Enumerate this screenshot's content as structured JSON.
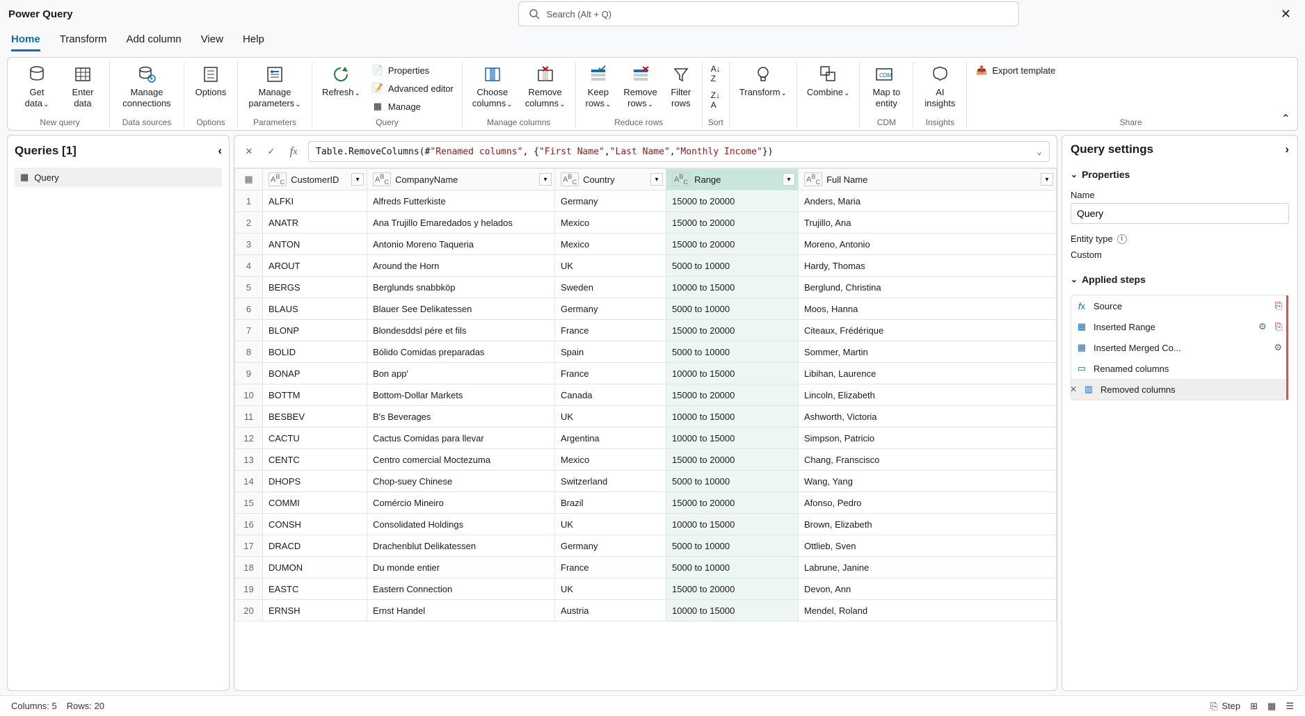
{
  "title": "Power Query",
  "search_placeholder": "Search (Alt + Q)",
  "tabs": [
    "Home",
    "Transform",
    "Add column",
    "View",
    "Help"
  ],
  "active_tab": 0,
  "ribbon": {
    "new_query": {
      "get_data": "Get\ndata",
      "enter_data": "Enter\ndata",
      "label": "New query"
    },
    "data_sources": {
      "manage_connections": "Manage\nconnections",
      "label": "Data sources"
    },
    "options_group": {
      "options": "Options",
      "label": "Options"
    },
    "parameters": {
      "manage_parameters": "Manage\nparameters",
      "label": "Parameters"
    },
    "query": {
      "refresh": "Refresh",
      "properties": "Properties",
      "advanced_editor": "Advanced editor",
      "manage": "Manage",
      "label": "Query"
    },
    "manage_columns": {
      "choose": "Choose\ncolumns",
      "remove": "Remove\ncolumns",
      "label": "Manage columns"
    },
    "reduce_rows": {
      "keep": "Keep\nrows",
      "remove": "Remove\nrows",
      "filter": "Filter\nrows",
      "label": "Reduce rows"
    },
    "sort": {
      "label": "Sort"
    },
    "transform": {
      "transform": "Transform",
      "label": ""
    },
    "combine": {
      "combine": "Combine",
      "label": ""
    },
    "cdm": {
      "map": "Map to\nentity",
      "label": "CDM"
    },
    "insights": {
      "ai": "AI\ninsights",
      "label": "Insights"
    },
    "share": {
      "export": "Export template",
      "label": "Share"
    }
  },
  "queries": {
    "header": "Queries [1]",
    "items": [
      {
        "name": "Query"
      }
    ]
  },
  "formula": {
    "prefix": "Table.RemoveColumns(#",
    "arg1": "\"Renamed columns\"",
    "sep1": ", {",
    "s1": "\"First Name\"",
    "c1": ", ",
    "s2": "\"Last Name\"",
    "c2": ", ",
    "s3": "\"Monthly Income\"",
    "suffix": "})"
  },
  "columns": [
    {
      "name": "CustomerID",
      "type": "ABC"
    },
    {
      "name": "CompanyName",
      "type": "ABC"
    },
    {
      "name": "Country",
      "type": "ABC"
    },
    {
      "name": "Range",
      "type": "ABC",
      "selected": true
    },
    {
      "name": "Full Name",
      "type": "ABC"
    }
  ],
  "rows": [
    [
      "ALFKI",
      "Alfreds Futterkiste",
      "Germany",
      "15000 to 20000",
      "Anders, Maria"
    ],
    [
      "ANATR",
      "Ana Trujillo Emaredados y helados",
      "Mexico",
      "15000 to 20000",
      "Trujillo, Ana"
    ],
    [
      "ANTON",
      "Antonio Moreno Taqueria",
      "Mexico",
      "15000 to 20000",
      "Moreno, Antonio"
    ],
    [
      "AROUT",
      "Around the Horn",
      "UK",
      "5000 to 10000",
      "Hardy, Thomas"
    ],
    [
      "BERGS",
      "Berglunds snabbköp",
      "Sweden",
      "10000 to 15000",
      "Berglund, Christina"
    ],
    [
      "BLAUS",
      "Blauer See Delikatessen",
      "Germany",
      "5000 to 10000",
      "Moos, Hanna"
    ],
    [
      "BLONP",
      "Blondesddsl pére et fils",
      "France",
      "15000 to 20000",
      "Citeaux, Frédérique"
    ],
    [
      "BOLID",
      "Bólido Comidas preparadas",
      "Spain",
      "5000 to 10000",
      "Sommer, Martin"
    ],
    [
      "BONAP",
      "Bon app'",
      "France",
      "10000 to 15000",
      "Libihan, Laurence"
    ],
    [
      "BOTTM",
      "Bottom-Dollar Markets",
      "Canada",
      "15000 to 20000",
      "Lincoln, Elizabeth"
    ],
    [
      "BESBEV",
      "B's Beverages",
      "UK",
      "10000 to 15000",
      "Ashworth, Victoria"
    ],
    [
      "CACTU",
      "Cactus Comidas para llevar",
      "Argentina",
      "10000 to 15000",
      "Simpson, Patricio"
    ],
    [
      "CENTC",
      "Centro comercial Moctezuma",
      "Mexico",
      "15000 to 20000",
      "Chang, Franscisco"
    ],
    [
      "DHOPS",
      "Chop-suey Chinese",
      "Switzerland",
      "5000 to 10000",
      "Wang, Yang"
    ],
    [
      "COMMI",
      "Comércio Mineiro",
      "Brazil",
      "15000 to 20000",
      "Afonso, Pedro"
    ],
    [
      "CONSH",
      "Consolidated Holdings",
      "UK",
      "10000 to 15000",
      "Brown, Elizabeth"
    ],
    [
      "DRACD",
      "Drachenblut Delikatessen",
      "Germany",
      "5000 to 10000",
      "Ottlieb, Sven"
    ],
    [
      "DUMON",
      "Du monde entier",
      "France",
      "5000 to 10000",
      "Labrune, Janine"
    ],
    [
      "EASTC",
      "Eastern Connection",
      "UK",
      "15000 to 20000",
      "Devon, Ann"
    ],
    [
      "ERNSH",
      "Ernst Handel",
      "Austria",
      "10000 to 15000",
      "Mendel, Roland"
    ]
  ],
  "settings": {
    "header": "Query settings",
    "properties": "Properties",
    "name_label": "Name",
    "name_value": "Query",
    "entity_type_label": "Entity type",
    "entity_type_value": "Custom",
    "applied_steps_label": "Applied steps",
    "steps": [
      {
        "name": "Source",
        "gear": false,
        "extra": true
      },
      {
        "name": "Inserted Range",
        "gear": true,
        "extra": true
      },
      {
        "name": "Inserted Merged Co...",
        "gear": true
      },
      {
        "name": "Renamed columns"
      },
      {
        "name": "Removed columns",
        "selected": true
      }
    ]
  },
  "status": {
    "cols": "Columns: 5",
    "rows": "Rows: 20",
    "step": "Step"
  }
}
